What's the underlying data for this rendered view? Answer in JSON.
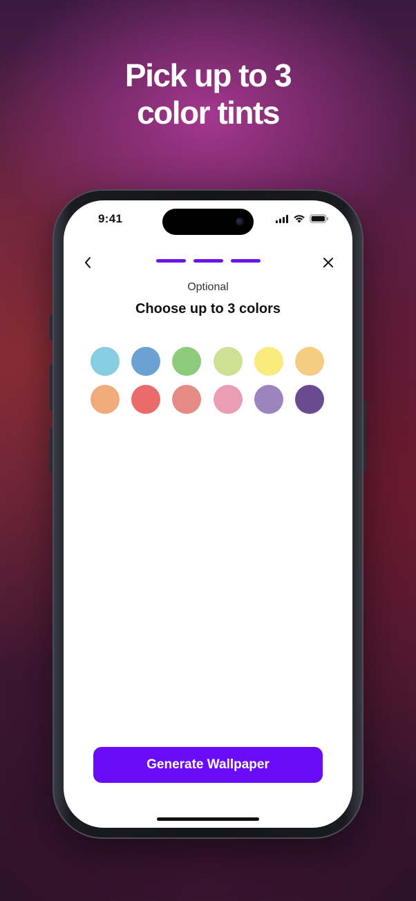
{
  "headline": {
    "line1": "Pick up to 3",
    "line2": "color tints"
  },
  "status_bar": {
    "time": "9:41",
    "icons": [
      "cellular-signal-icon",
      "wifi-icon",
      "battery-icon"
    ]
  },
  "nav": {
    "back_icon": "chevron-left-icon",
    "close_icon": "close-icon",
    "progress_steps": 3,
    "progress_color": "#6a14f0"
  },
  "content": {
    "subtitle": "Optional",
    "title": "Choose up to 3 colors"
  },
  "swatches": [
    {
      "name": "light-blue",
      "color": "#86cde1"
    },
    {
      "name": "blue",
      "color": "#6ba1d3"
    },
    {
      "name": "green",
      "color": "#8ccc7a"
    },
    {
      "name": "lime",
      "color": "#cde094"
    },
    {
      "name": "yellow",
      "color": "#f9ec7c"
    },
    {
      "name": "light-orange",
      "color": "#f4cd82"
    },
    {
      "name": "orange",
      "color": "#f0aa7b"
    },
    {
      "name": "red",
      "color": "#eb6b6a"
    },
    {
      "name": "salmon",
      "color": "#e68a86"
    },
    {
      "name": "pink",
      "color": "#eb9db3"
    },
    {
      "name": "lavender",
      "color": "#9c84be"
    },
    {
      "name": "purple",
      "color": "#6a4b8f"
    }
  ],
  "cta": {
    "label": "Generate Wallpaper",
    "color": "#6a0cf7"
  }
}
